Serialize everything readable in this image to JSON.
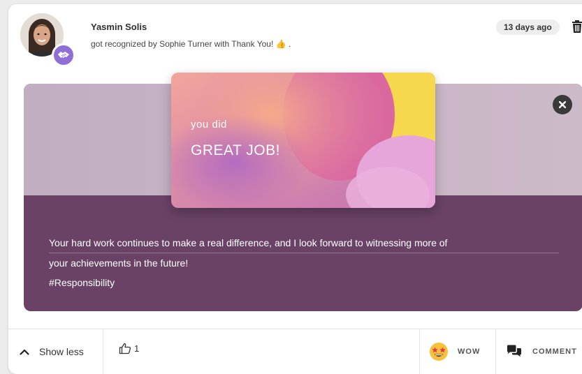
{
  "post": {
    "user_name": "Yasmin Solis",
    "activity": "got recognized by Sophie Turner with Thank You!",
    "activity_emoji": "👍",
    "activity_suffix": ".",
    "time_ago": "13 days ago"
  },
  "card": {
    "line1": "you did",
    "line2": "GREAT JOB!"
  },
  "message": {
    "line1": "Your hard work continues to make a real difference, and I look forward to witnessing more of",
    "line2": "your achievements in the future!",
    "tag": "#Responsibility"
  },
  "footer": {
    "show_less_label": "Show less",
    "like_count": "1",
    "wow_label": "WOW",
    "comment_label": "COMMENT"
  },
  "icons": {
    "badge": "handshake-icon",
    "delete": "trash-icon",
    "close": "close-icon",
    "collapse": "chevron-up-icon",
    "like": "thumbs-up-icon",
    "wow": "star-struck-emoji-icon",
    "comment": "comment-bubbles-icon"
  },
  "colors": {
    "badge_bg": "#8f6fd6",
    "media_bottom": "#6a4266",
    "media_top": "#c8b4c6",
    "close_bg": "#3a3a3a"
  }
}
